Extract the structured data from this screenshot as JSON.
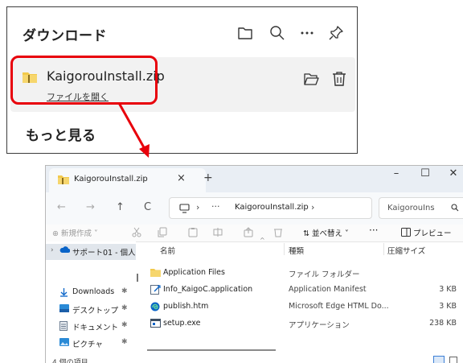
{
  "download_panel": {
    "title": "ダウンロード",
    "item": {
      "filename": "KaigorouInstall.zip",
      "open_link": "ファイルを開く"
    },
    "see_more": "もっと見る"
  },
  "explorer": {
    "tab": {
      "title": "KaigorouInstall.zip",
      "close": "×",
      "new": "+"
    },
    "window_controls": {
      "minimize": "–",
      "maximize": "☐",
      "close": "✕"
    },
    "nav": {
      "back": "←",
      "forward": "→",
      "up": "↑",
      "refresh": "C"
    },
    "address": {
      "chevron1": "›",
      "dots": "···",
      "path": "KaigorouInstall.zip",
      "chevron2": "›"
    },
    "search": {
      "placeholder": "KaigorouIns"
    },
    "toolbar": {
      "new": "⊕ 新規作成 ˅",
      "sort": "⇅ 並べ替え ˅",
      "more": "···",
      "preview": "プレビュー"
    },
    "sidebar": {
      "items": [
        {
          "label": "サポート01 - 個人"
        },
        {
          "label": "Downloads"
        },
        {
          "label": "デスクトップ"
        },
        {
          "label": "ドキュメント"
        },
        {
          "label": "ピクチャ"
        }
      ]
    },
    "status": "4 個の項目",
    "columns": {
      "name": "名前",
      "type": "種類",
      "size": "圧縮サイズ"
    },
    "files": [
      {
        "name": "Application Files",
        "type": "ファイル フォルダー",
        "size": ""
      },
      {
        "name": "Info_KaigoC.application",
        "type": "Application Manifest",
        "size": "3 KB"
      },
      {
        "name": "publish.htm",
        "type": "Microsoft Edge HTML Do...",
        "size": "3 KB"
      },
      {
        "name": "setup.exe",
        "type": "アプリケーション",
        "size": "238 KB"
      }
    ]
  },
  "colors": {
    "highlight": "#e8000b",
    "arrow": "#e8000b",
    "folder": "#f2c94c",
    "accent": "#0a64c8"
  }
}
